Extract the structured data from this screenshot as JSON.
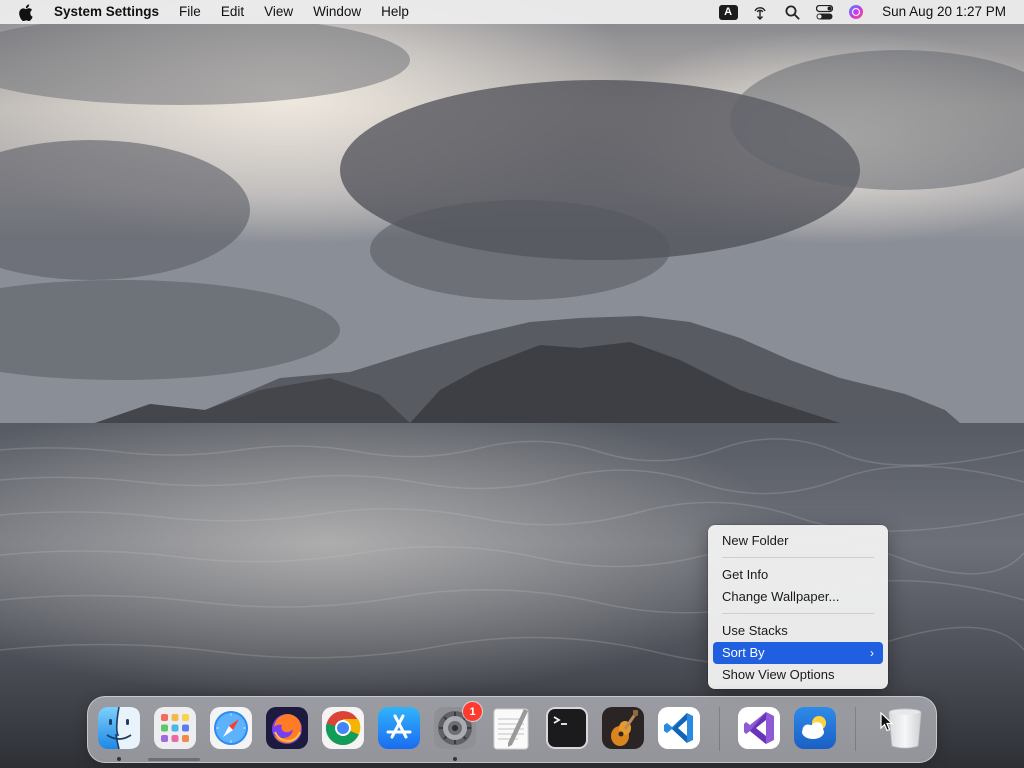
{
  "menubar": {
    "app_name": "System Settings",
    "menus": [
      "File",
      "Edit",
      "View",
      "Window",
      "Help"
    ],
    "input_source": "A",
    "clock": "Sun Aug 20  1:27 PM",
    "status_icons": [
      "input-source-icon",
      "airdrop-icon",
      "spotlight-search-icon",
      "control-center-icon",
      "siri-icon"
    ]
  },
  "context_menu": {
    "items": [
      {
        "label": "New Folder"
      },
      {
        "label": "Get Info"
      },
      {
        "label": "Change Wallpaper..."
      },
      {
        "label": "Use Stacks"
      },
      {
        "label": "Sort By",
        "submenu": true,
        "highlighted": true
      },
      {
        "label": "Show View Options"
      }
    ],
    "chevron": "›"
  },
  "dock": {
    "apps": [
      {
        "name": "finder",
        "running": true
      },
      {
        "name": "launchpad",
        "running": false
      },
      {
        "name": "safari",
        "running": false
      },
      {
        "name": "firefox",
        "running": false
      },
      {
        "name": "chrome",
        "running": false
      },
      {
        "name": "app-store",
        "running": false
      },
      {
        "name": "system-settings",
        "running": true,
        "badge": "1"
      },
      {
        "name": "textedit",
        "running": false
      },
      {
        "name": "terminal",
        "running": false
      },
      {
        "name": "garageband",
        "running": false
      },
      {
        "name": "vscode",
        "running": false
      },
      {
        "name": "visual-studio",
        "running": false
      },
      {
        "name": "weather",
        "running": false
      },
      {
        "name": "trash",
        "running": false
      }
    ],
    "badge": "1"
  },
  "colors": {
    "menu_highlight": "#1f5fe0",
    "badge_red": "#ff3b30"
  }
}
